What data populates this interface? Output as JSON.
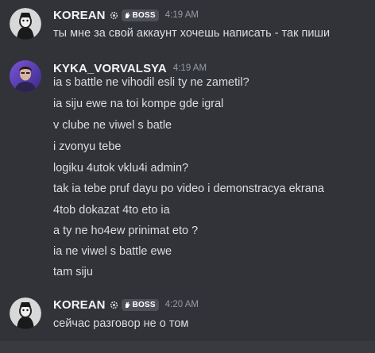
{
  "messages": [
    {
      "author": "KOREAN",
      "badge": "BOSS",
      "avatar_icon": "masked-figure-avatar",
      "time": "4:19 AM",
      "lines": [
        "ты мне за свой аккаунт хочешь написать - так пиши"
      ]
    },
    {
      "author": "KYKA_VORVALSYA",
      "avatar_icon": "purple-photo-avatar",
      "time": "4:19 AM",
      "lines": [
        "ia s battle ne vihodil esli ty ne zametil?",
        "ia siju ewe na toi kompe gde igral",
        "v clube ne viwel s batle",
        "i zvonyu tebe",
        "logiku 4utok vklu4i admin?",
        "tak ia tebe pruf dayu po video i demonstracya ekrana",
        "4tob dokazat 4to eto ia",
        "a ty ne ho4ew prinimat eto ?",
        "ia ne viwel s battle ewe",
        "tam siju"
      ]
    },
    {
      "author": "KOREAN",
      "badge": "BOSS",
      "avatar_icon": "masked-figure-avatar",
      "time": "4:20 AM",
      "lines": [
        "сейчас разговор не о том"
      ]
    }
  ],
  "colors": {
    "background": "#323339",
    "text": "#dbdee1",
    "username": "#f2f3f5",
    "timestamp": "#949ba4",
    "badge_bg": "#4e5058"
  }
}
